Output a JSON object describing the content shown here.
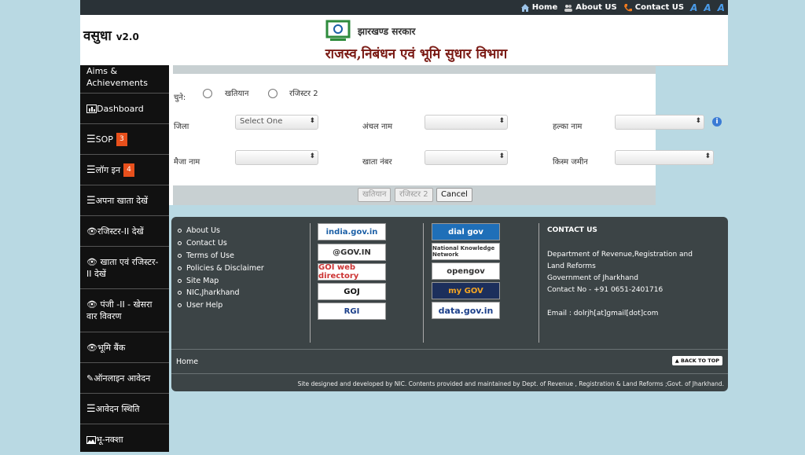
{
  "topbar": {
    "home": "Home",
    "about": "About US",
    "contact": "Contact US",
    "font_sizes": [
      "A",
      "A",
      "A"
    ]
  },
  "header": {
    "brand": "वसुधा",
    "version": "v2.0",
    "govt": "झारखण्ड सरकार",
    "dept": "राजस्व,निबंधन एवं भूमि सुधार विभाग"
  },
  "sidebar": {
    "items": [
      {
        "label": "Aims & Achievements",
        "icon": "none"
      },
      {
        "label": "Dashboard",
        "icon": "bar-chart-icon"
      },
      {
        "label": "SOP",
        "badge": "3",
        "icon": "list-icon"
      },
      {
        "label": "लॉग इन",
        "badge": "4",
        "icon": "list-icon"
      },
      {
        "label": "अपना खाता देखें",
        "icon": "list-icon"
      },
      {
        "label": "रजिस्टर-II देखें",
        "icon": "eye-icon"
      },
      {
        "label": "खाता एवं रजिस्टर-II देखें",
        "icon": "eye-icon"
      },
      {
        "label": "पंजी -II - खेसरा वार विवरण",
        "icon": "eye-icon"
      },
      {
        "label": "भूमि बैंक",
        "icon": "eye-icon"
      },
      {
        "label": "ऑनलाइन आवेदन",
        "icon": "edit-icon"
      },
      {
        "label": "आवेदन स्थिति",
        "icon": "list-icon"
      },
      {
        "label": "भू-नक्शा",
        "icon": "image-icon"
      }
    ]
  },
  "form": {
    "choose_label": "चुने:",
    "radio1": "खतियान",
    "radio2": "रजिस्टर 2",
    "district_label": "जिला",
    "district_value": "Select One",
    "circle_label": "अंचल नाम",
    "halka_label": "हल्का नाम",
    "mauza_label": "मैजा नाम",
    "khata_label": "खाता नंबर",
    "land_type_label": "किस्म जमीन",
    "btn_khatiyan": "खतियान",
    "btn_register2": "रजिस्टर 2",
    "btn_cancel": "Cancel"
  },
  "footer": {
    "links": [
      "About Us",
      "Contact Us",
      "Terms of Use",
      "Policies & Disclaimer",
      "Site Map",
      "NIC,Jharkhand",
      "User Help"
    ],
    "logos_left": [
      "india.gov.in",
      "@GOV.IN",
      "GOI web directory",
      "GOJ",
      "RGI"
    ],
    "logos_right": [
      "dial gov",
      "National Knowledge Network",
      "opengov",
      "my GOV",
      "data.gov.in"
    ],
    "contact_title": "CONTACT US",
    "contact_lines": [
      "Department of Revenue,Registration and",
      "Land Reforms",
      "Government of Jharkhand",
      "Contact No - +91 0651-2401716"
    ],
    "email": "Email : dolrjh[at]gmail[dot]com",
    "home": "Home",
    "back_to_top": "BACK TO TOP",
    "credit": "Site designed and developed by NIC. Contents provided and maintained by Dept. of Revenue , Registration & Land Reforms ;Govt. of Jharkhand."
  }
}
